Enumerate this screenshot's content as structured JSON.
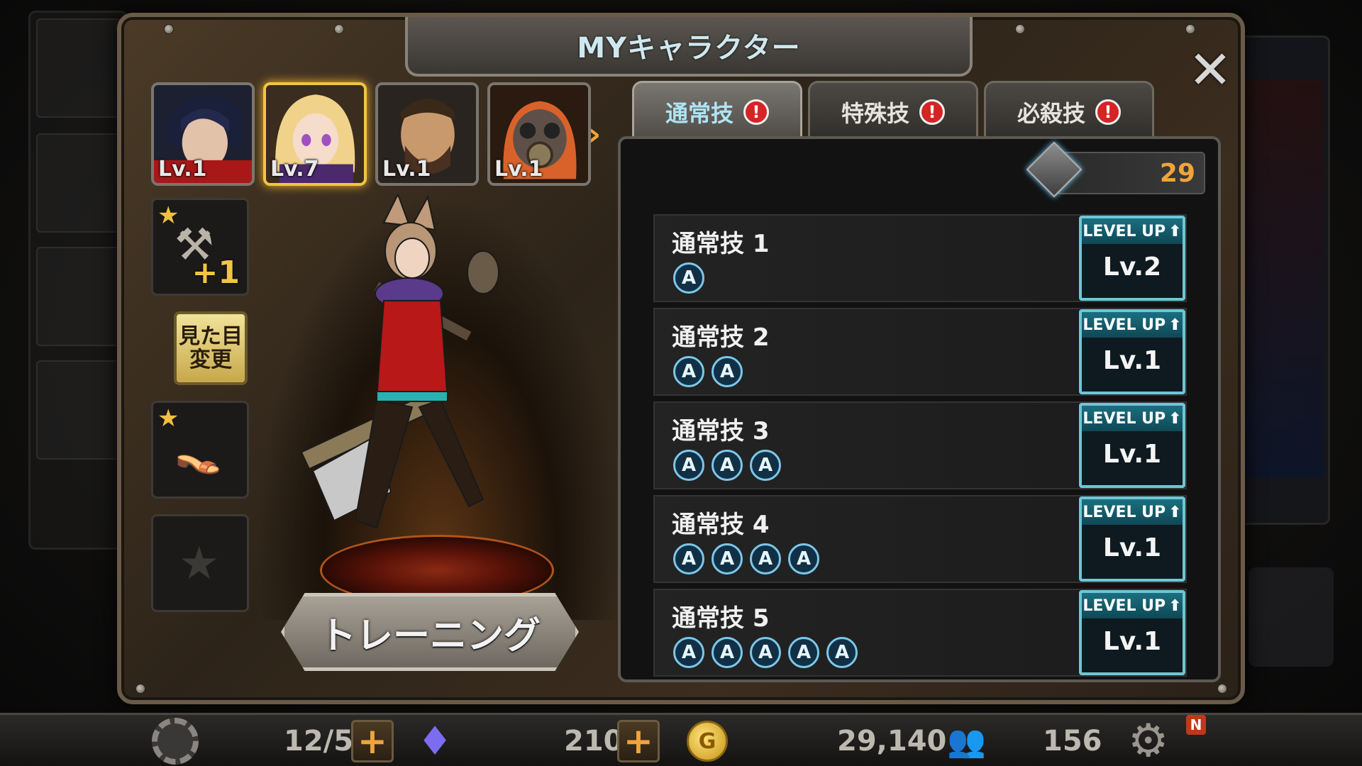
{
  "dialog": {
    "title": "MYキャラクター",
    "close_icon": "close-icon"
  },
  "portraits": [
    {
      "level": "Lv.1",
      "icon": "dark-hair-hero-portrait",
      "selected": false
    },
    {
      "level": "Lv.7",
      "icon": "blonde-girl-portrait",
      "selected": true
    },
    {
      "level": "Lv.1",
      "icon": "bearded-man-portrait",
      "selected": false
    },
    {
      "level": "Lv.1",
      "icon": "gasmask-portrait",
      "selected": false
    }
  ],
  "equipment": {
    "weapon_plus": "+1",
    "appearance_button": "見た目\n変更"
  },
  "train_button": "トレーニング",
  "tabs": [
    {
      "label": "通常技",
      "active": true
    },
    {
      "label": "特殊技",
      "active": false
    },
    {
      "label": "必殺技",
      "active": false
    }
  ],
  "tab_alert_glyph": "!",
  "currency": {
    "icon": "cube-icon",
    "value": "29"
  },
  "skills": [
    {
      "name": "通常技 1",
      "chips": [
        "A"
      ],
      "button_label": "LEVEL UP",
      "level": "Lv.2"
    },
    {
      "name": "通常技 2",
      "chips": [
        "A",
        "A"
      ],
      "button_label": "LEVEL UP",
      "level": "Lv.1"
    },
    {
      "name": "通常技 3",
      "chips": [
        "A",
        "A",
        "A"
      ],
      "button_label": "LEVEL UP",
      "level": "Lv.1"
    },
    {
      "name": "通常技 4",
      "chips": [
        "A",
        "A",
        "A",
        "A"
      ],
      "button_label": "LEVEL UP",
      "level": "Lv.1"
    },
    {
      "name": "通常技 5",
      "chips": [
        "A",
        "A",
        "A",
        "A",
        "A"
      ],
      "button_label": "LEVEL UP",
      "level": "Lv.1"
    }
  ],
  "bottom_bar": {
    "stamina": "12/5",
    "gems": "210",
    "gold": "29,140",
    "friends": "156",
    "notification_badge": "N"
  },
  "colors": {
    "accent_orange": "#f0a43a",
    "tab_active_text": "#aee4f4",
    "levelup_border": "#6ec6d6",
    "alert_red": "#d42424"
  }
}
